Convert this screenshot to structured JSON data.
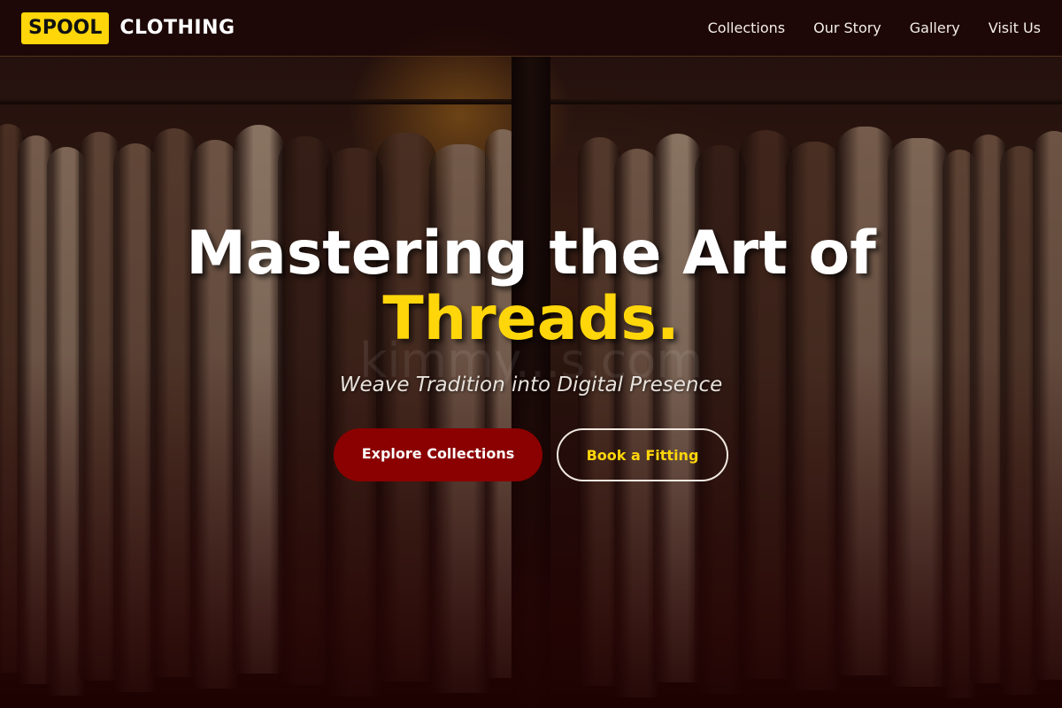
{
  "brand": {
    "badge": "SPOOL",
    "name": "CLOTHING"
  },
  "nav": {
    "items": [
      "Collections",
      "Our Story",
      "Gallery",
      "Visit Us"
    ]
  },
  "hero": {
    "headline_line1": "Mastering the Art of",
    "headline_accent": "Threads.",
    "watermark": "kimmy...s.com",
    "subtitle": "Weave Tradition into Digital Presence",
    "primary_button": "Explore Collections",
    "secondary_button": "Book a Fitting"
  },
  "colors": {
    "accent_yellow": "#ffd60a",
    "primary_red": "#8b0000",
    "nav_background": "#1c0606"
  }
}
